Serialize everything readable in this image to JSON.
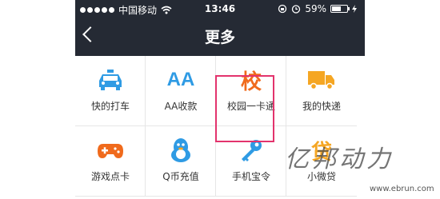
{
  "status_bar": {
    "carrier": "中国移动",
    "time": "13:46",
    "battery_percent": "59%",
    "battery_level": 0.59,
    "signal_bars": 5
  },
  "nav": {
    "title": "更多",
    "back_icon": "chevron-left-icon"
  },
  "grid": {
    "items": [
      {
        "label": "快的打车",
        "icon": "taxi-icon",
        "color": "#2f9be4"
      },
      {
        "label": "AA收款",
        "icon": "aa-icon",
        "color": "#2f9be4",
        "glyph": "AA"
      },
      {
        "label": "校园一卡通",
        "icon": "campus-card-icon",
        "color": "#f06a1c",
        "glyph": "校"
      },
      {
        "label": "我的快递",
        "icon": "delivery-truck-icon",
        "color": "#f5a623"
      },
      {
        "label": "游戏点卡",
        "icon": "gamepad-icon",
        "color": "#f06a1c"
      },
      {
        "label": "Q币充值",
        "icon": "qq-penguin-icon",
        "color": "#2f9be4"
      },
      {
        "label": "手机宝令",
        "icon": "key-icon",
        "color": "#2f9be4"
      },
      {
        "label": "小微贷",
        "icon": "loan-icon",
        "color": "#f5a623",
        "glyph": "贷"
      }
    ]
  },
  "highlight_color": "#e3336d",
  "watermark": {
    "text": "亿邦动力",
    "url": "www.ebrun.com"
  }
}
